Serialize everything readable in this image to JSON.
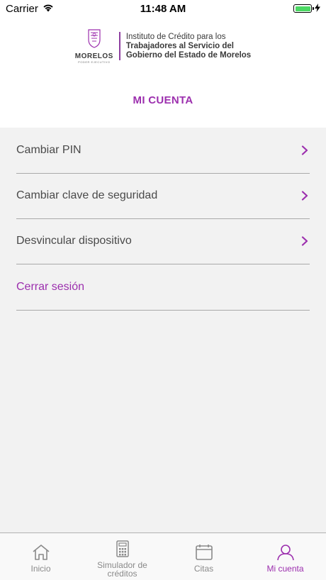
{
  "status_bar": {
    "carrier": "Carrier",
    "time": "11:48 AM"
  },
  "header": {
    "seal_name": "MORELOS",
    "seal_subtitle": "PODER EJECUTIVO",
    "line1": "Instituto de Crédito para los",
    "line2": "Trabajadores al Servicio del",
    "line3": "Gobierno del Estado de Morelos"
  },
  "page_title": "MI CUENTA",
  "menu": {
    "items": [
      {
        "label": "Cambiar PIN"
      },
      {
        "label": "Cambiar clave de seguridad"
      },
      {
        "label": "Desvincular dispositivo"
      }
    ],
    "logout_label": "Cerrar sesión"
  },
  "tabbar": {
    "tabs": [
      {
        "label": "Inicio",
        "icon": "home-icon"
      },
      {
        "label": "Simulador de\ncréditos",
        "icon": "calculator-icon"
      },
      {
        "label": "Citas",
        "icon": "calendar-icon"
      },
      {
        "label": "Mi cuenta",
        "icon": "user-icon"
      }
    ],
    "active_index": 3
  },
  "colors": {
    "accent": "#9c2fae",
    "panel_bg": "#f2f2f2",
    "battery": "#4cd964"
  }
}
